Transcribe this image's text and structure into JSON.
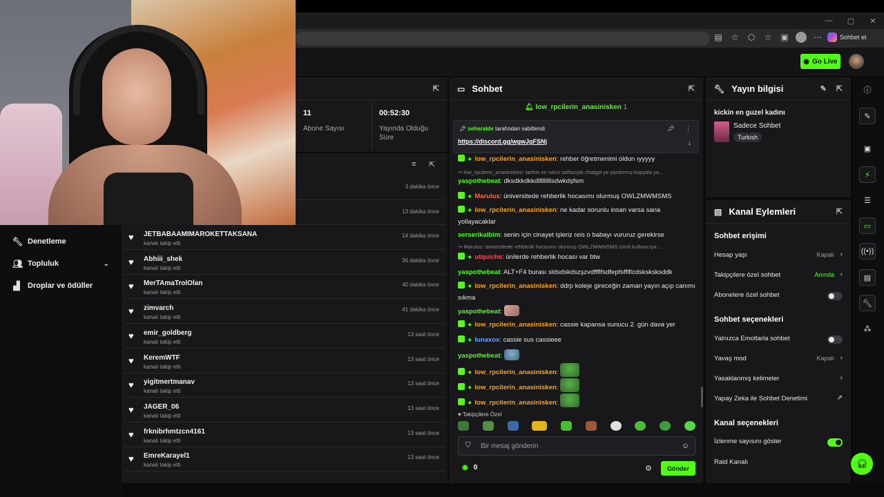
{
  "browser": {
    "copilot_label": "Sohbet et"
  },
  "header": {
    "go_live": "Go Live"
  },
  "nav": {
    "items": [
      {
        "label": "Denetleme",
        "icon": "wrench-icon"
      },
      {
        "label": "Topluluk",
        "icon": "people-icon"
      },
      {
        "label": "Droplar ve ödüller",
        "icon": "gift-icon"
      }
    ]
  },
  "stats": {
    "subs_value": "11",
    "subs_label": "Abone Sayısı",
    "live_value": "00:52:30",
    "live_label": "Yayında Olduğu Süre"
  },
  "follows": {
    "top_times": [
      "3 dakika önce",
      "13 dakika önce"
    ],
    "rows": [
      {
        "name": "JETBABAAMIMAROKETTAKSANA",
        "sub": "kanalı takip etti",
        "time": "14 dakika önce"
      },
      {
        "name": "Abhiii_shek",
        "sub": "kanalı takip etti",
        "time": "36 dakika önce"
      },
      {
        "name": "MerTAmaTrolOlan",
        "sub": "kanalı takip etti",
        "time": "40 dakika önce"
      },
      {
        "name": "zimvarch",
        "sub": "kanalı takip etti",
        "time": "41 dakika önce"
      },
      {
        "name": "emir_goldberg",
        "sub": "kanalı takip etti",
        "time": "13 saat önce"
      },
      {
        "name": "KeremWTF",
        "sub": "kanalı takip etti",
        "time": "13 saat önce"
      },
      {
        "name": "yigitmertmanav",
        "sub": "kanalı takip etti",
        "time": "13 saat önce"
      },
      {
        "name": "JAGER_06",
        "sub": "kanalı takip etti",
        "time": "13 saat önce"
      },
      {
        "name": "frknibrhmtzcn4161",
        "sub": "kanalı takip etti",
        "time": "13 saat önce"
      },
      {
        "name": "EmreKarayel1",
        "sub": "kanalı takip etti",
        "time": "13 saat önce"
      }
    ]
  },
  "chat": {
    "title": "Sohbet",
    "top_user": "low_rpcilerin_anasinisken",
    "top_count": "1",
    "pinned_by_user": "seheralde",
    "pinned_by_suffix": "tarafından sabitlendi",
    "pinned_link": "https://discord.gg/wgwJgFSNj",
    "messages": [
      {
        "user": "low_rpcilerin_anasinisken",
        "color": "#f5a623",
        "text": ": rehber öğretmenimi oldun ıyyyyy",
        "badges": true
      },
      {
        "reply": "low_rpcilerin_anasinisken: tarihin en sıkıcı istifasıydı chatgpt ye yazdırmış kopyala ya..."
      },
      {
        "user": "yaspothebeat",
        "color": "#53fc18",
        "text": ": dksdkkdkkdlllllllllsdwkdşfsm"
      },
      {
        "user": "Marulus",
        "color": "#ff6a3d",
        "text": ": üniversitede rehberlik hocasımı olurmuş OWLZMWMSMS",
        "badges": true
      },
      {
        "user": "low_rpcilerin_anasinisken",
        "color": "#f5a623",
        "text": ": ne kadar sorunlu insan varsa sana yollayacaklar",
        "badges": true
      },
      {
        "user": "serserikalbim",
        "color": "#53fc18",
        "text": ": senin için cinayet işleriz reis o babayı vururuz gerekirse"
      },
      {
        "reply": "Marulus: üniversitede rehberlik hocasımı olurmuş OWLZMWMSMS isimli kullanıcıya ..."
      },
      {
        "user": "utquiche",
        "color": "#ff4d4d",
        "text": ": ünilerde rehberlik hocası var btw",
        "badges": true
      },
      {
        "user": "yaspothebeat",
        "color": "#53fc18",
        "text": ": ALT+F4 burası sldsdskdszşzvdffflfsdfepfsfflflcdsksksksddk"
      },
      {
        "user": "low_rpcilerin_anasinisken",
        "color": "#f5a623",
        "text": ": ddrp koleje gireceğin zaman yayın açıp canımı sıkma",
        "badges": true
      },
      {
        "user": "yaspothebeat",
        "color": "#53fc18",
        "text": ":",
        "emote": "hand"
      },
      {
        "user": "low_rpcilerin_anasinisken",
        "color": "#f5a623",
        "text": ": cassie kapansa sunucu 2. gün dava yer",
        "badges": true
      },
      {
        "user": "lunaxox",
        "color": "#6aa8ff",
        "text": ": cassie sus cassieee",
        "badges": true
      },
      {
        "user": "yaspothebeat",
        "color": "#53fc18",
        "text": ":",
        "emote": "pepe"
      },
      {
        "user": "low_rpcilerin_anasinisken",
        "color": "#f5a623",
        "text": ":",
        "emote": "frog",
        "badges": true
      },
      {
        "user": "low_rpcilerin_anasinisken",
        "color": "#f5a623",
        "text": ":",
        "emote": "frog",
        "badges": true
      },
      {
        "user": "low_rpcilerin_anasinisken",
        "color": "#f5a623",
        "text": ":",
        "emote": "frog",
        "badges": true
      }
    ],
    "emote_section_label": "Takipçilere Özel",
    "input_placeholder": "Bir mesaj gönderin",
    "viewer_count": "0",
    "send_label": "Gönder"
  },
  "info": {
    "title": "Yayın bilgisi",
    "stream_title": "kickin en guzel kadını",
    "category": "Sadece Sohbet",
    "tag": "Turkish"
  },
  "actions": {
    "title": "Kanal Eylemleri",
    "chat_access": "Sohbet erişimi",
    "account_age": "Hesap yaşı",
    "account_age_val": "Kapalı",
    "followers_only": "Takipçilere özel sohbet",
    "followers_only_val": "Anında",
    "subs_only": "Abonelere özel sohbet",
    "chat_options": "Sohbet seçenekleri",
    "emote_only": "Yalnızca Emotlarla sohbet",
    "slow_mode": "Yavaş mod",
    "slow_mode_val": "Kapalı",
    "banned_words": "Yasaklanmış kelimeler",
    "ai_mod": "Yapay Zeka ile Sohbet Denetimi",
    "channel_options": "Kanal seçenekleri",
    "show_viewers": "İzlenme sayısını göster",
    "raid": "Raid Kanalı"
  }
}
